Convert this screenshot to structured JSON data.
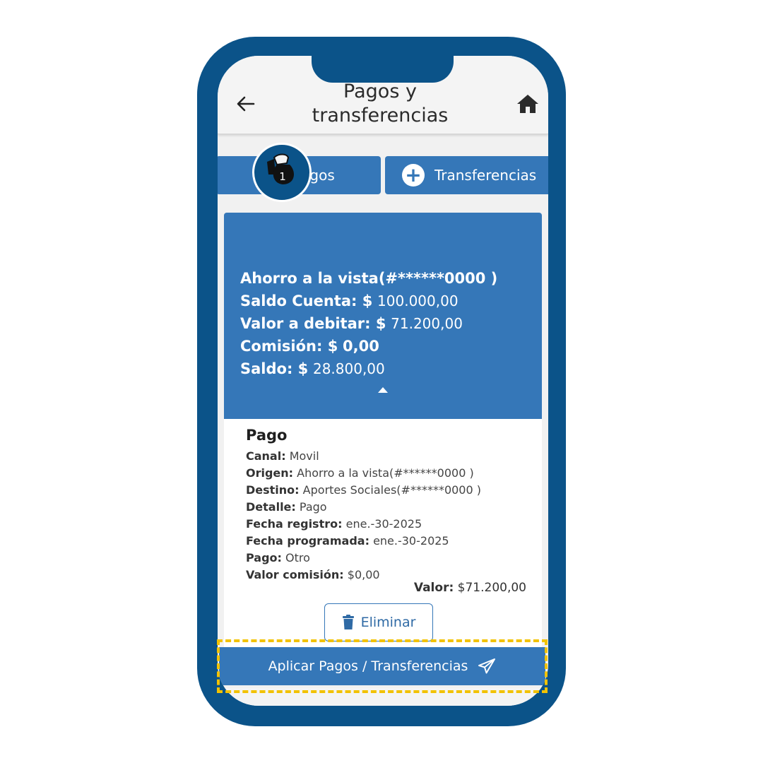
{
  "header": {
    "title_line1": "Pagos y",
    "title_line2": "transferencias",
    "back_icon": "arrow-left-icon",
    "home_icon": "home-icon"
  },
  "actions": {
    "pagos_label": "Pagos",
    "transferencias_label": "Transferencias",
    "plus_symbol": "+"
  },
  "account": {
    "name": "Ahorro a la vista(#******0000 )",
    "saldo_label": "Saldo Cuenta: $",
    "saldo_value": "100.000,00",
    "debitar_label": "Valor a debitar: $",
    "debitar_value": "71.200,00",
    "comision_label": "Comisión: $",
    "comision_value": "0,00",
    "saldo_final_label": "Saldo: $",
    "saldo_final_value": "28.800,00",
    "badge_count": "1",
    "badge_icon": "money-bag-hand-icon"
  },
  "detail": {
    "title": "Pago",
    "rows": [
      {
        "label": "Canal:",
        "value": "Movil"
      },
      {
        "label": "Origen:",
        "value": "Ahorro a la vista(#******0000 )"
      },
      {
        "label": "Destino:",
        "value": "Aportes Sociales(#******0000 )"
      },
      {
        "label": "Detalle:",
        "value": "Pago"
      },
      {
        "label": "Fecha registro:",
        "value": "ene.-30-2025"
      },
      {
        "label": "Fecha programada:",
        "value": "ene.-30-2025"
      },
      {
        "label": "Pago:",
        "value": "Otro"
      },
      {
        "label": "Valor comisión:",
        "value": "$0,00"
      }
    ],
    "total_label": "Valor:",
    "total_value": "$71.200,00",
    "delete_label": "Eliminar"
  },
  "footer": {
    "apply_label": "Aplicar Pagos / Transferencias",
    "apply_icon": "send-icon"
  },
  "colors": {
    "frame": "#0b5389",
    "primary": "#3577b8",
    "highlight": "#f2c200"
  }
}
